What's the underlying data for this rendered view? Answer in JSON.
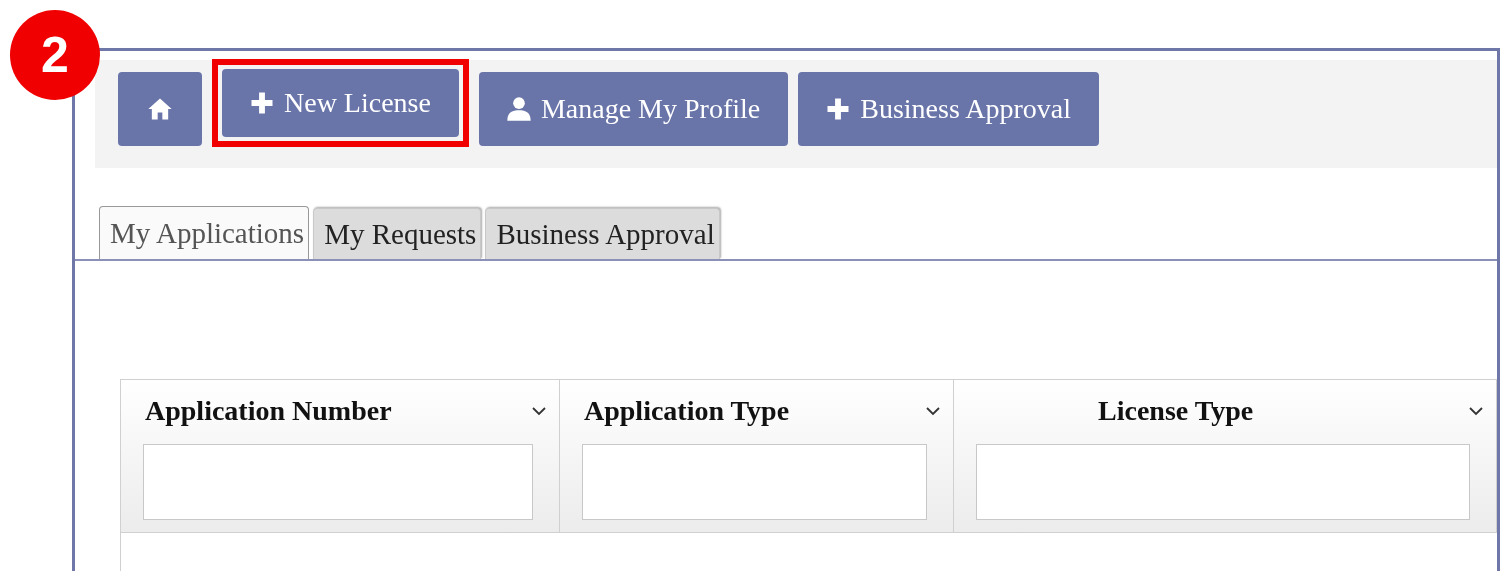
{
  "step_badge": "2",
  "toolbar": {
    "buttons": [
      {
        "kind": "home",
        "highlighted": false
      },
      {
        "kind": "add",
        "label": "New License",
        "highlighted": true
      },
      {
        "kind": "profile",
        "label": "Manage My Profile",
        "highlighted": false
      },
      {
        "kind": "add",
        "label": "Business Approval",
        "highlighted": false
      }
    ]
  },
  "tabs": [
    {
      "label": "My Applications",
      "selected": true
    },
    {
      "label": "My Requests",
      "selected": false
    },
    {
      "label": "Business Approval",
      "selected": false
    }
  ],
  "table": {
    "columns": [
      {
        "label": "Application Number"
      },
      {
        "label": "Application Type"
      },
      {
        "label": "License Type"
      }
    ]
  }
}
